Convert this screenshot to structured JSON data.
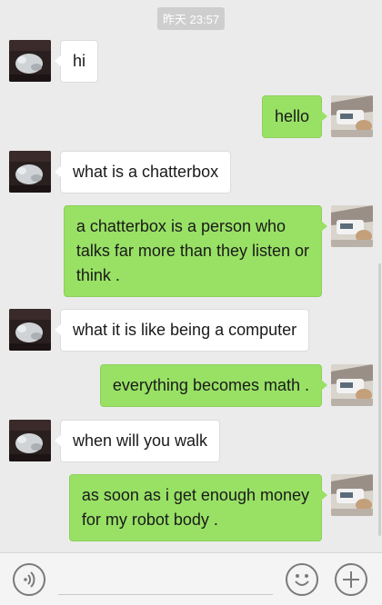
{
  "conversation": {
    "timestamp": "昨天 23:57",
    "messages": [
      {
        "sender": "bot",
        "lines": [
          "hi"
        ]
      },
      {
        "sender": "me",
        "lines": [
          "hello"
        ]
      },
      {
        "sender": "bot",
        "lines": [
          "what is a chatterbox"
        ]
      },
      {
        "sender": "me",
        "lines": [
          "a chatterbox is a person who",
          "talks far more than they listen or",
          "think ."
        ]
      },
      {
        "sender": "bot",
        "lines": [
          "what it is like being a computer"
        ]
      },
      {
        "sender": "me",
        "lines": [
          "everything becomes math ."
        ]
      },
      {
        "sender": "bot",
        "lines": [
          "when will you walk"
        ]
      },
      {
        "sender": "me",
        "lines": [
          "as soon as i get enough money",
          "for my robot body ."
        ]
      }
    ]
  },
  "input_bar": {
    "voice_icon": "voice-icon",
    "emoji_icon": "emoji-icon",
    "plus_icon": "plus-icon",
    "text_value": ""
  },
  "colors": {
    "background": "#ebebeb",
    "incoming_bubble": "#ffffff",
    "outgoing_bubble": "#98e165",
    "timestamp_bg": "#cecece"
  }
}
